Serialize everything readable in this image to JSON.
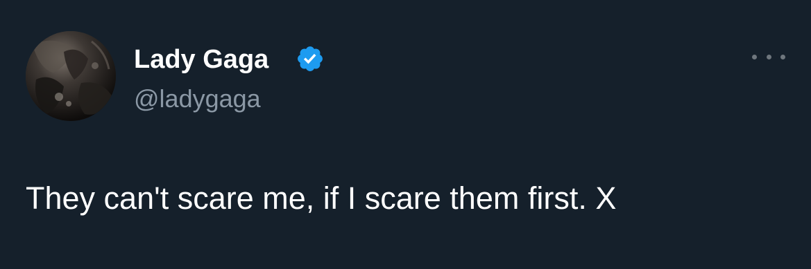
{
  "tweet": {
    "author": {
      "name": "Lady Gaga",
      "handle": "@ladygaga",
      "verified": true
    },
    "text": "They can't scare me, if I scare them first. X",
    "more_icon": "more-horizontal-icon"
  },
  "colors": {
    "background": "#15202b",
    "name_text": "#ffffff",
    "handle_text": "#8b98a5",
    "body_text": "#ffffff",
    "verified_badge": "#1d9bf0",
    "more_dots": "#6e767d"
  }
}
